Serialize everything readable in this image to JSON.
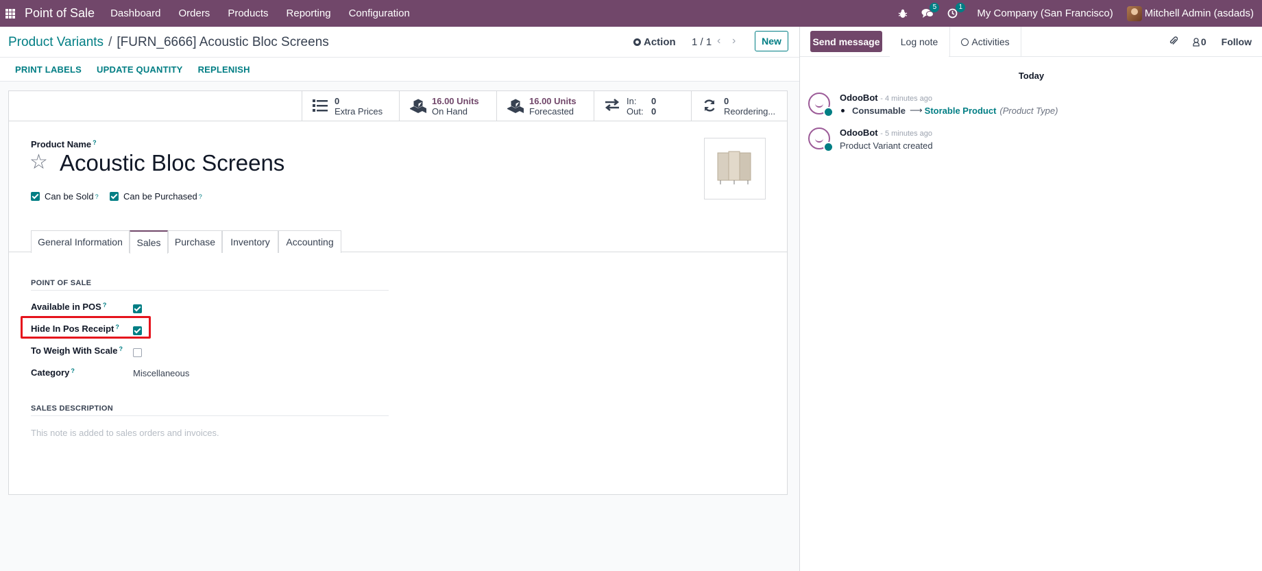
{
  "navbar": {
    "app_name": "Point of Sale",
    "menu": [
      "Dashboard",
      "Orders",
      "Products",
      "Reporting",
      "Configuration"
    ],
    "messages_count": "5",
    "activities_count": "1",
    "company": "My Company (San Francisco)",
    "user": "Mitchell Admin (asdads)"
  },
  "control": {
    "breadcrumb_root": "Product Variants",
    "breadcrumb_sep": "/",
    "breadcrumb_current": "[FURN_6666] Acoustic Bloc Screens",
    "action_label": "Action",
    "pager": "1 / 1",
    "new_label": "New"
  },
  "buttons": [
    "PRINT LABELS",
    "UPDATE QUANTITY",
    "REPLENISH"
  ],
  "stats": {
    "extra_prices": {
      "value": "0",
      "label": "Extra Prices"
    },
    "on_hand": {
      "value": "16.00 Units",
      "label": "On Hand"
    },
    "forecasted": {
      "value": "16.00 Units",
      "label": "Forecasted"
    },
    "in_out": {
      "in_label": "In:",
      "in_value": "0",
      "out_label": "Out:",
      "out_value": "0"
    },
    "reordering": {
      "value": "0",
      "label": "Reordering..."
    }
  },
  "form": {
    "product_name_label": "Product Name",
    "product_name": "Acoustic Bloc Screens",
    "can_be_sold_label": "Can be Sold",
    "can_be_sold": true,
    "can_be_purchased_label": "Can be Purchased",
    "can_be_purchased": true,
    "help_mark": "?"
  },
  "tabs": [
    "General Information",
    "Sales",
    "Purchase",
    "Inventory",
    "Accounting"
  ],
  "active_tab": "Sales",
  "sales": {
    "pos_section": "POINT OF SALE",
    "available_in_pos_label": "Available in POS",
    "available_in_pos": true,
    "hide_in_receipt_label": "Hide In Pos Receipt",
    "hide_in_receipt": true,
    "to_weigh_label": "To Weigh With Scale",
    "to_weigh": false,
    "category_label": "Category",
    "category": "Miscellaneous",
    "desc_section": "SALES DESCRIPTION",
    "desc_placeholder": "This note is added to sales orders and invoices."
  },
  "chatter": {
    "send_message": "Send message",
    "log_note": "Log note",
    "activities": "Activities",
    "followers_count": "0",
    "follow": "Follow",
    "today": "Today",
    "messages": [
      {
        "author": "OdooBot",
        "time": "- 4 minutes ago",
        "old_value": "Consumable",
        "new_value": "Storable Product",
        "field": "(Product Type)"
      },
      {
        "author": "OdooBot",
        "time": "- 5 minutes ago",
        "body": "Product Variant created"
      }
    ]
  },
  "colors": {
    "brand": "#71476a",
    "accent": "#017e84",
    "highlight": "#e5131c"
  }
}
